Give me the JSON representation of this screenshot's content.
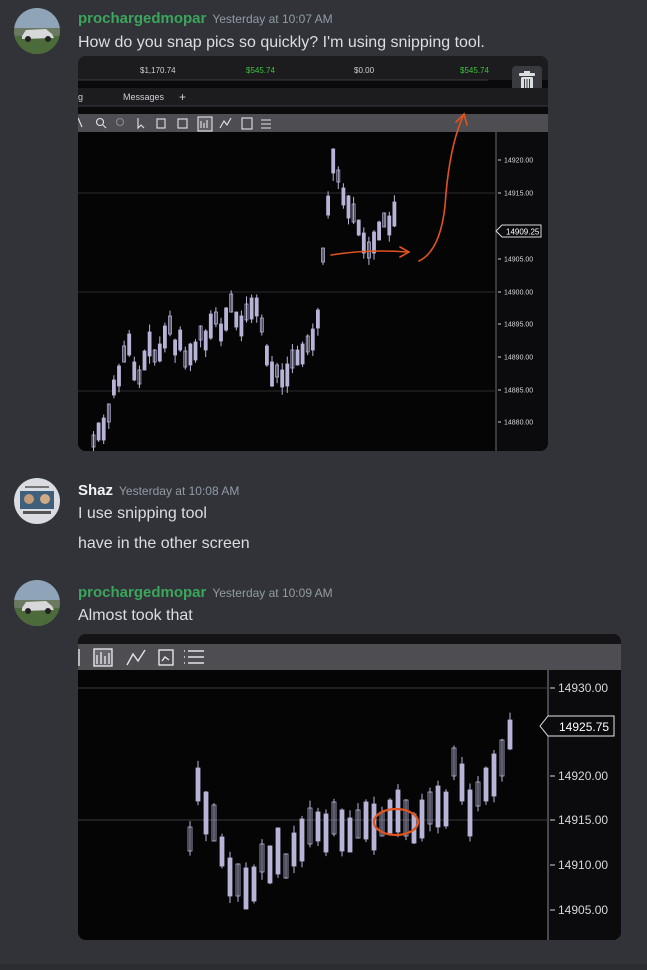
{
  "header": {
    "username": "prochargedmopar",
    "timestamp": "Yesterday at 10:07 AM"
  },
  "messages": [
    {
      "username": "prochargedmopar",
      "username_color": "#3ba55c",
      "timestamp": "Yesterday at 10:07 AM",
      "lines": [
        "How do you snap pics so quickly? I'm using snipping tool."
      ]
    },
    {
      "username": "Shaz",
      "username_color": "#f2f3f5",
      "timestamp": "Yesterday at 10:08 AM",
      "lines": [
        "I use snipping tool",
        "have in the other screen"
      ]
    },
    {
      "username": "prochargedmopar",
      "username_color": "#3ba55c",
      "timestamp": "Yesterday at 10:09 AM",
      "lines": [
        "Almost took that"
      ]
    }
  ],
  "shot1": {
    "account_values": [
      "$1,170.74",
      "$545.74",
      "$0.00",
      "$545.74"
    ],
    "tab_label": "Messages",
    "price_ticks": [
      "14920.00",
      "14915.00",
      "14905.00",
      "14900.00",
      "14895.00",
      "14890.00",
      "14885.00",
      "14880.00"
    ],
    "current_price": "14909.25",
    "annotation_color": "#e0531f"
  },
  "shot2": {
    "price_ticks": [
      "14930.00",
      "14920.00",
      "14915.00",
      "14910.00",
      "14905.00"
    ],
    "current_price": "14925.75",
    "annotation_color": "#e0531f"
  },
  "colors": {
    "background": "#313338",
    "text": "#dbdee1",
    "muted": "#949ba4",
    "candle": "#b7b4d8"
  }
}
